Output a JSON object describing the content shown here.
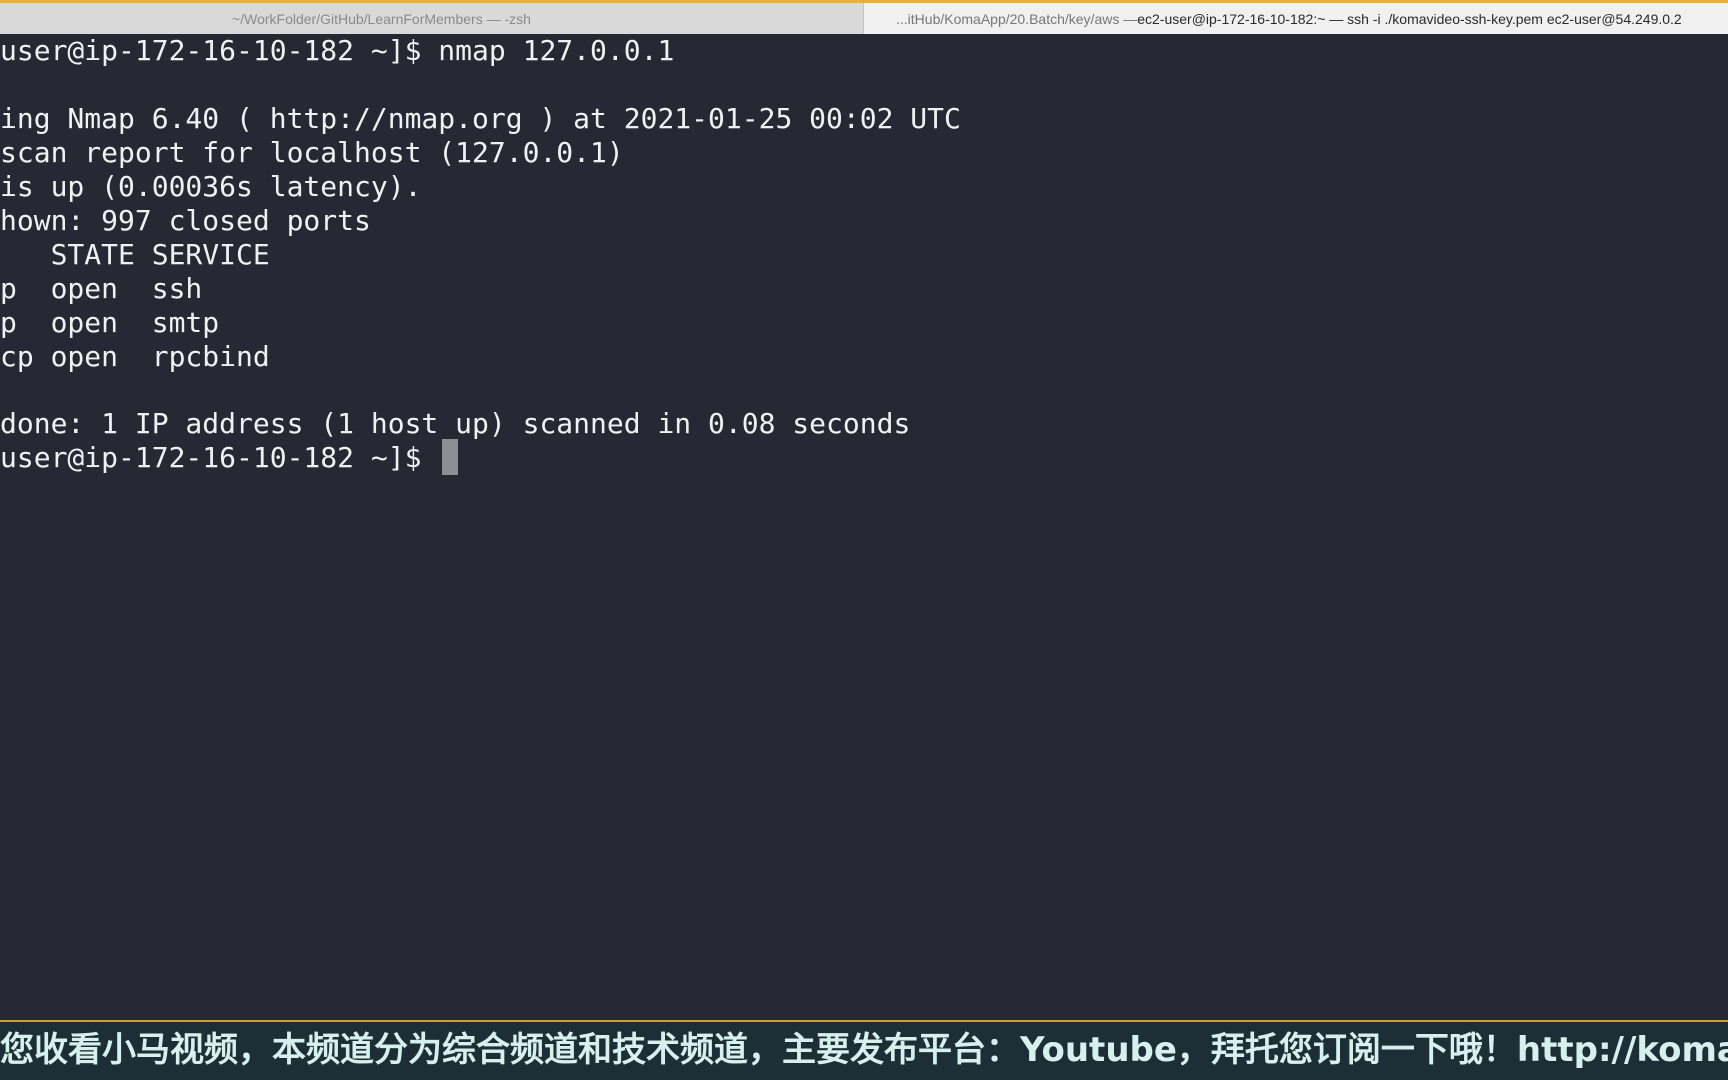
{
  "tabs": [
    {
      "title": "~/WorkFolder/GitHub/LearnForMembers — -zsh",
      "active": false
    },
    {
      "title_prefix": "...itHub/KomaApp/20.Batch/key/aws — ",
      "title_main": "ec2-user@ip-172-16-10-182:~ — ssh -i ./komavideo-ssh-key.pem ec2-user@54.249.0.2",
      "active": true
    }
  ],
  "terminal": {
    "lines": [
      "user@ip-172-16-10-182 ~]$ nmap 127.0.0.1",
      "",
      "ing Nmap 6.40 ( http://nmap.org ) at 2021-01-25 00:02 UTC",
      "scan report for localhost (127.0.0.1)",
      "is up (0.00036s latency).",
      "hown: 997 closed ports",
      "   STATE SERVICE",
      "p  open  ssh",
      "p  open  smtp",
      "cp open  rpcbind",
      "",
      "done: 1 IP address (1 host up) scanned in 0.08 seconds"
    ],
    "prompt": "user@ip-172-16-10-182 ~]$ ",
    "colors": {
      "background": "#272834",
      "foreground": "#f1f1f3",
      "cursor": "#8e8f95"
    }
  },
  "banner": {
    "text": "您收看小马视频，本频道分为综合频道和技术频道，主要发布平台：Youtube，拜托您订阅一下哦！http://komavideo.co"
  }
}
